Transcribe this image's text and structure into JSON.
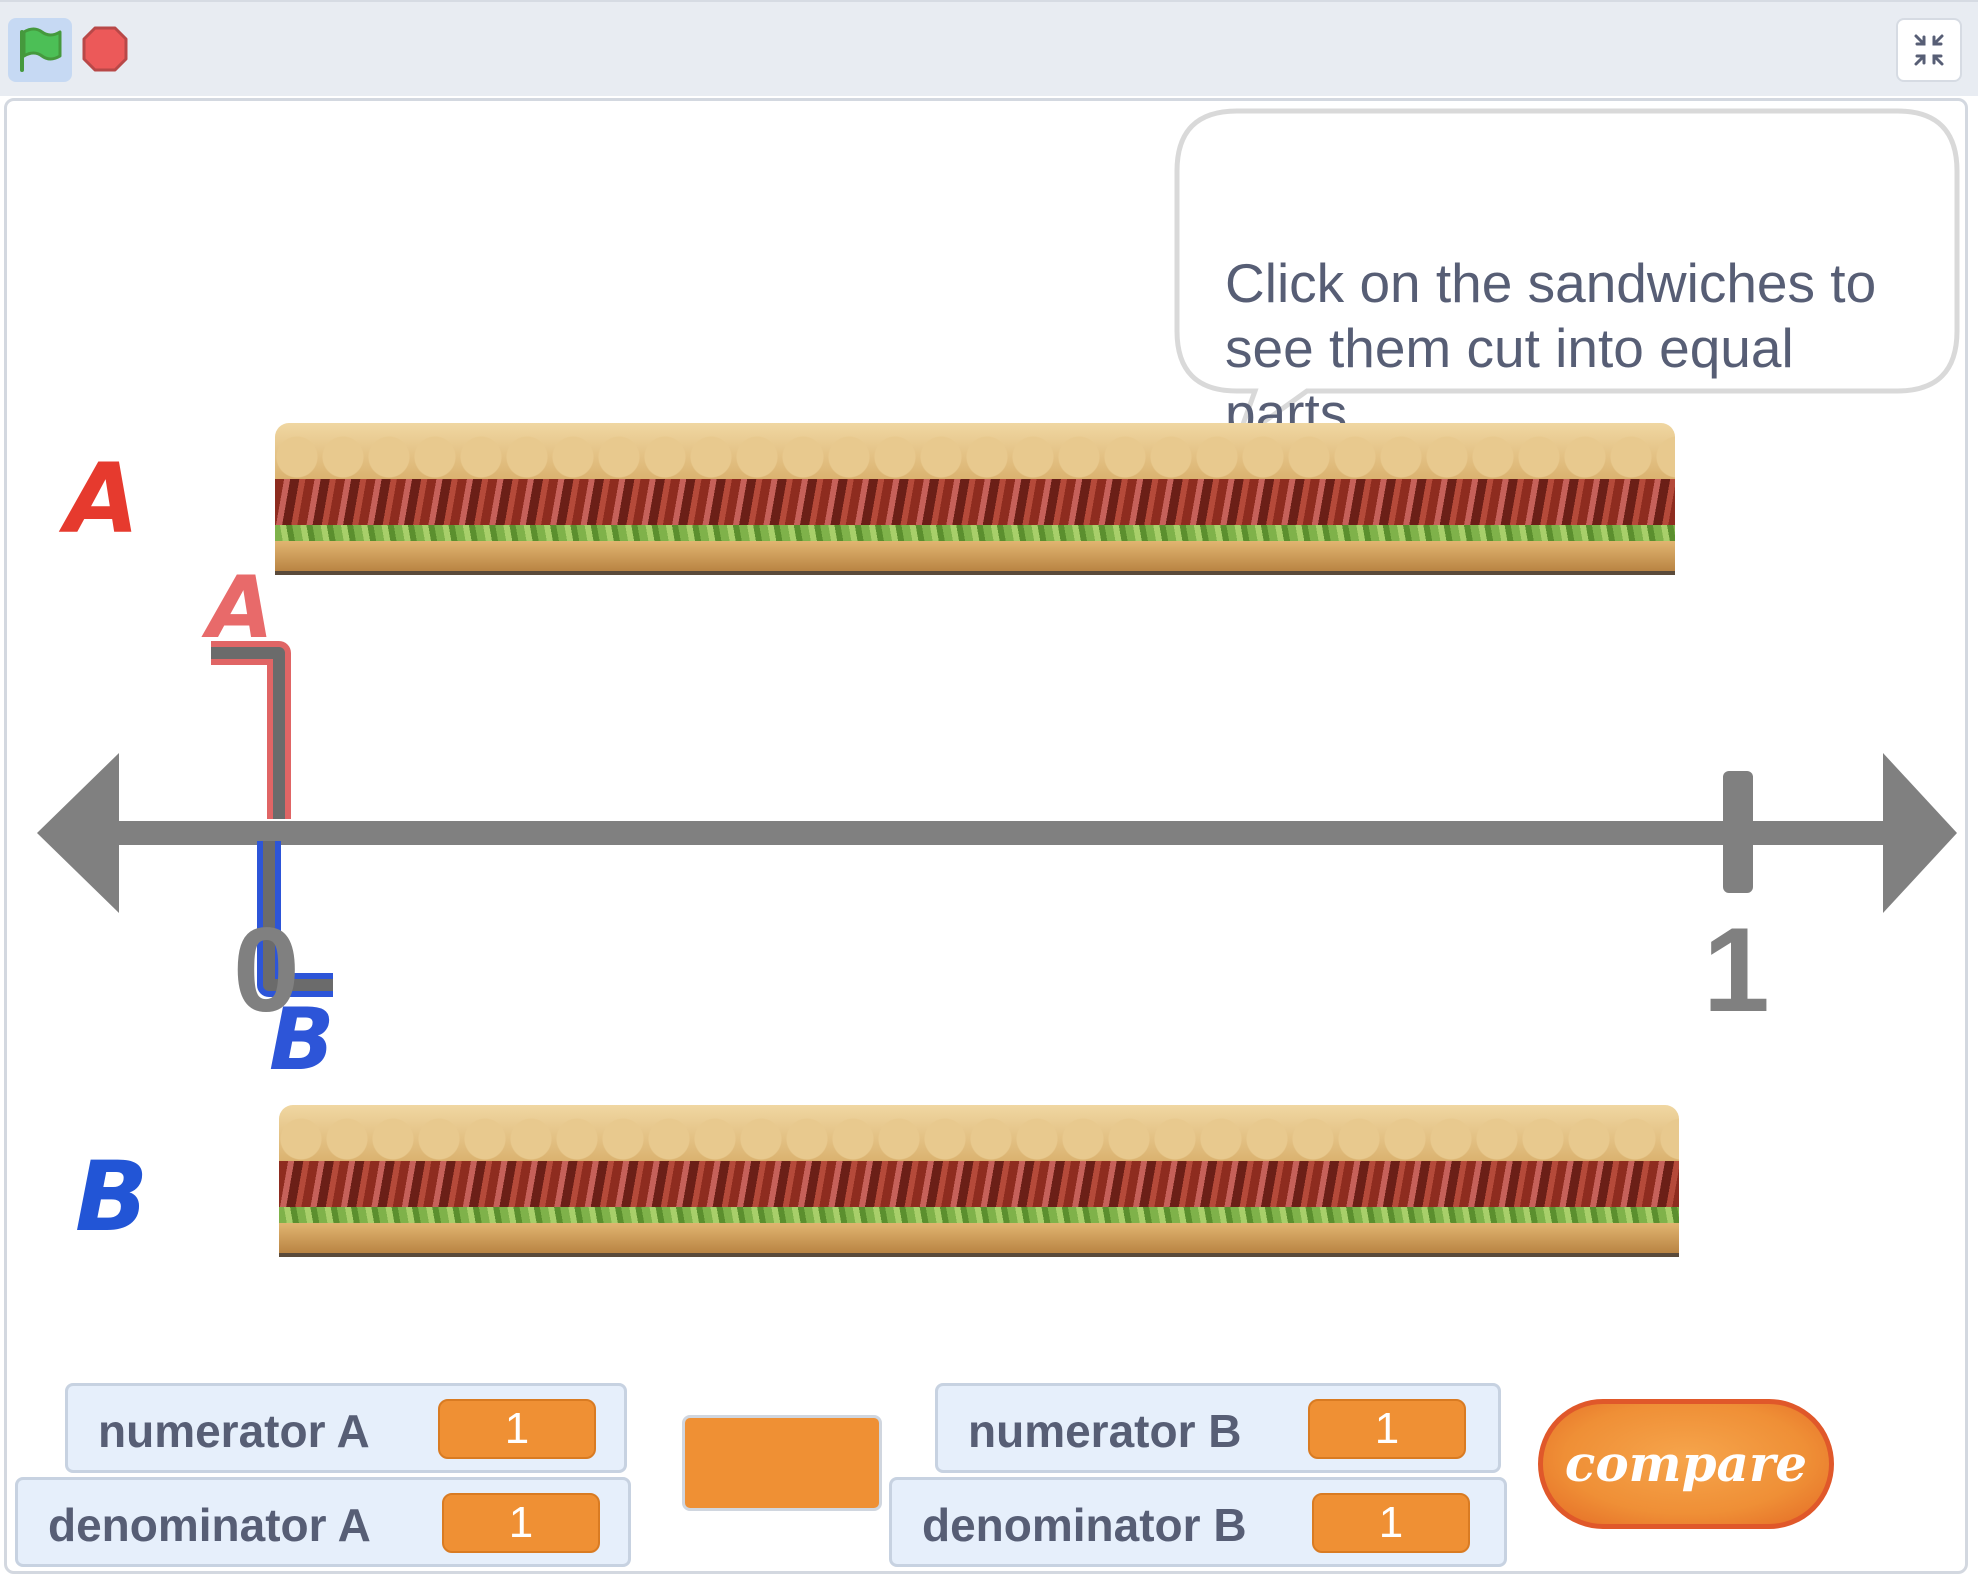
{
  "toolbar": {
    "green_flag_icon": "green-flag-icon",
    "stop_icon": "stop-icon",
    "small_stage_icon": "small-stage-icon"
  },
  "stage": {
    "speech_bubble": "Click on the sandwiches to see them cut into equal parts.",
    "label_a": "A",
    "label_b": "B",
    "marker_a_label": "A",
    "marker_b_label": "B",
    "number_line": {
      "tick_start": "0",
      "tick_end": "1"
    },
    "colors": {
      "label_a": "#e63a2e",
      "label_b": "#2255d6",
      "number_line": "#808080",
      "monitor_value": "#ef9034",
      "compare_button": "#ef8f36"
    }
  },
  "monitors": {
    "numerator_a": {
      "label": "numerator A",
      "value": "1"
    },
    "denominator_a": {
      "label": "denominator A",
      "value": "1"
    },
    "numerator_b": {
      "label": "numerator B",
      "value": "1"
    },
    "denominator_b": {
      "label": "denominator B",
      "value": "1"
    }
  },
  "compare_button": {
    "label": "compare"
  }
}
